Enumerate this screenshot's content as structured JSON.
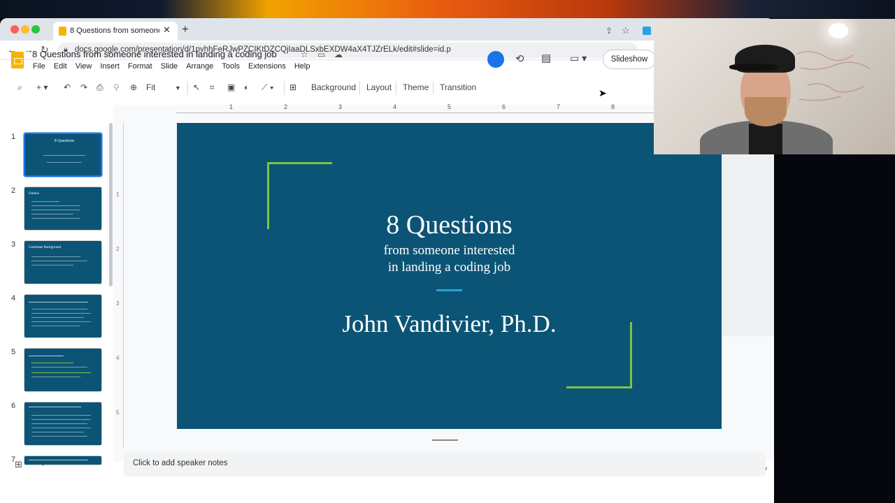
{
  "browser": {
    "tab_title": "8 Questions from someone inte",
    "url": "docs.google.com/presentation/d/1pvhhFeRJwPZCIKtDZCQjIaaDLSxbEXDW4aX4TJZrELk/edit#slide=id.p"
  },
  "doc": {
    "title": "8 Questions from someone interested in landing a coding job",
    "menu": [
      "File",
      "Edit",
      "View",
      "Insert",
      "Format",
      "Slide",
      "Arrange",
      "Tools",
      "Extensions",
      "Help"
    ],
    "slideshow_label": "Slideshow"
  },
  "toolbar": {
    "zoom": "Fit",
    "background": "Background",
    "layout": "Layout",
    "theme": "Theme",
    "transition": "Transition"
  },
  "ruler": {
    "h_ticks": [
      "1",
      "2",
      "3",
      "4",
      "5",
      "6",
      "7",
      "8"
    ],
    "v_ticks": [
      "1",
      "2",
      "3",
      "4",
      "5"
    ]
  },
  "filmstrip": {
    "slides": [
      {
        "num": "1",
        "title": "8 Questions"
      },
      {
        "num": "2",
        "title": "Outline"
      },
      {
        "num": "3",
        "title": "Candidate Background"
      },
      {
        "num": "4",
        "title": ""
      },
      {
        "num": "5",
        "title": ""
      },
      {
        "num": "6",
        "title": ""
      },
      {
        "num": "7",
        "title": ""
      }
    ]
  },
  "slide": {
    "title": "8 Questions",
    "subtitle_line1": "from someone interested",
    "subtitle_line2": "in landing a coding job",
    "author": "John Vandivier, Ph.D."
  },
  "notes": {
    "placeholder": "Click to add speaker notes"
  },
  "colors": {
    "slide_bg": "#0c5475",
    "accent_green": "#7dc444",
    "accent_blue": "#2aa3e0"
  }
}
